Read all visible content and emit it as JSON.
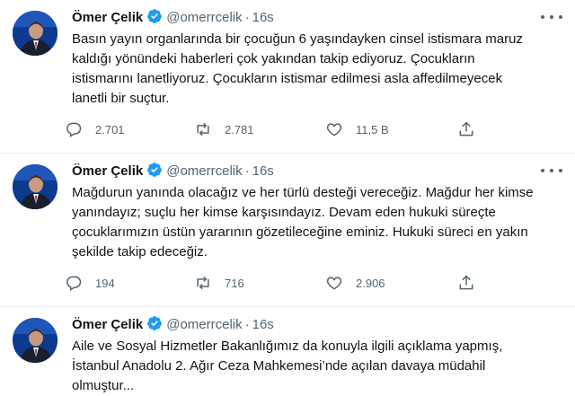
{
  "tweets": [
    {
      "name": "Ömer Çelik",
      "handle": "@omerrcelik",
      "time": "16s",
      "text": "Basın yayın organlarında bir çocuğun 6 yaşındayken cinsel istismara maruz\nkaldığı yönündeki haberleri çok yakından takip ediyoruz. Çocukların\nistismarını lanetliyoruz. Çocukların istismar edilmesi asla affedilmeyecek\nlanetli bir suçtur.",
      "replies": "2.701",
      "retweets": "2.781",
      "likes": "11,5 B"
    },
    {
      "name": "Ömer Çelik",
      "handle": "@omerrcelik",
      "time": "16s",
      "text": "Mağdurun yanında olacağız ve her türlü desteği vereceğiz. Mağdur her kimse\nyanındayız;  suçlu her kimse karşısındayız. Devam eden hukuki süreçte\nçocuklarımızın üstün yararının gözetileceğine eminiz. Hukuki süreci en yakın\nşekilde takip edeceğiz.",
      "replies": "194",
      "retweets": "716",
      "likes": "2.906"
    },
    {
      "name": "Ömer Çelik",
      "handle": "@omerrcelik",
      "time": "16s",
      "text": "Aile ve Sosyal Hizmetler Bakanlığımız da konuyla ilgili açıklama yapmış,\nİstanbul Anadolu 2. Ağır Ceza Mahkemesi’nde açılan davaya müdahil\nolmuştur..."
    }
  ],
  "icons": {
    "verified": "verified-badge-icon",
    "more": "more-dots-icon",
    "reply": "reply-icon",
    "retweet": "retweet-icon",
    "like": "heart-icon",
    "share": "share-icon"
  },
  "colors": {
    "verified": "#1d9bf0",
    "text": "#0f1419",
    "muted": "#536471",
    "divider": "#e6ecf0"
  }
}
